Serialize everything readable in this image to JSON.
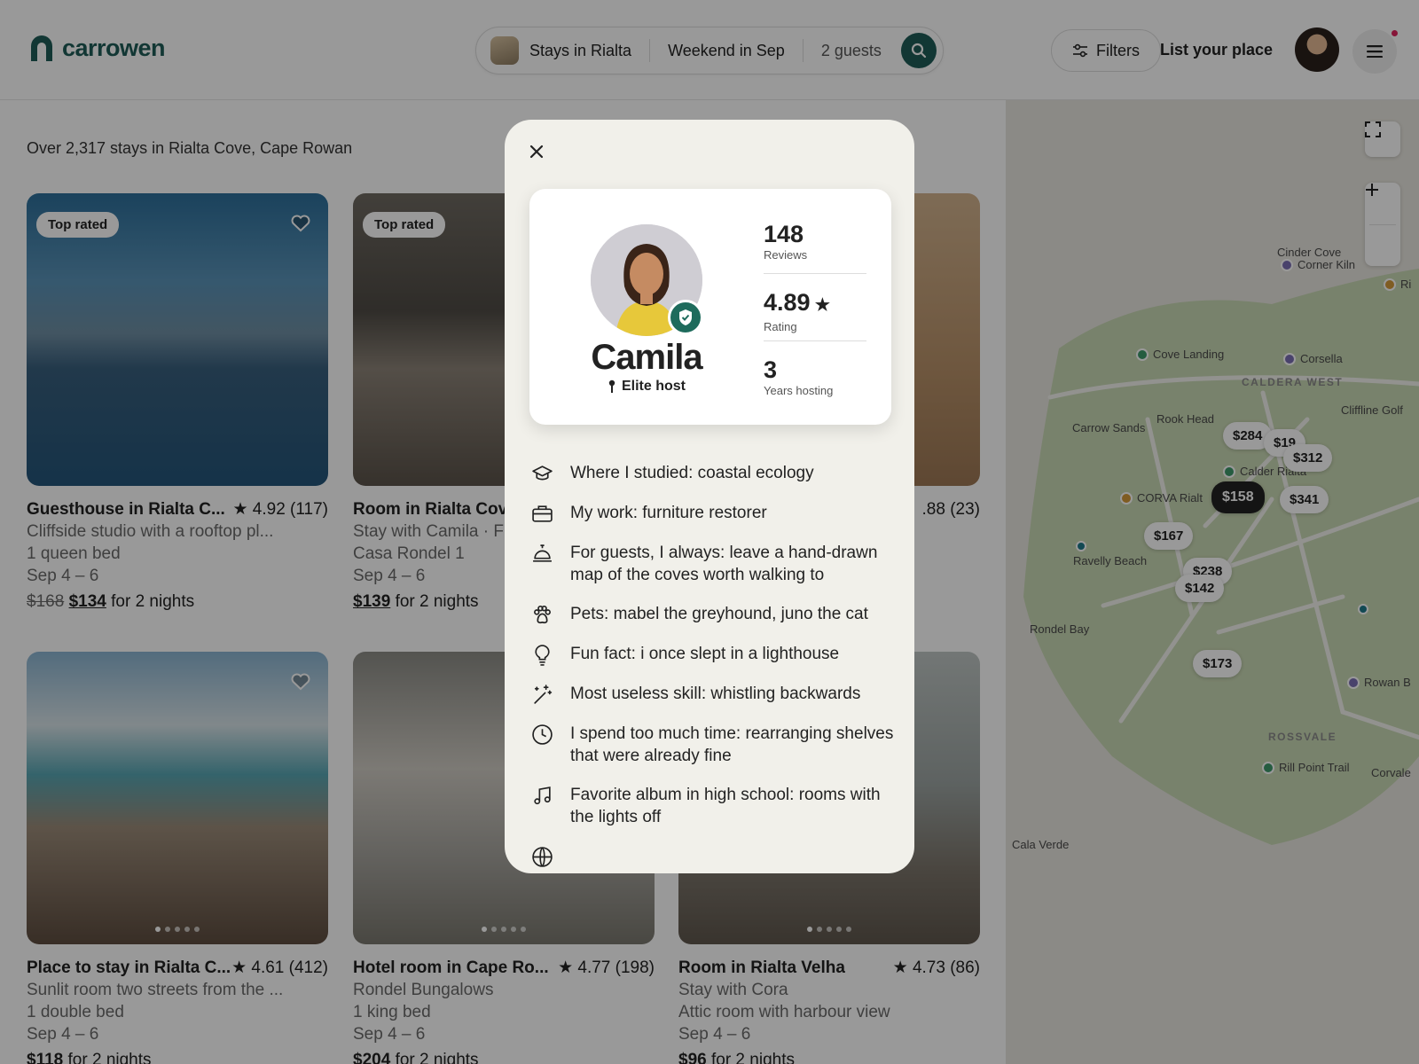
{
  "header": {
    "logo_text": "carrowen",
    "search": {
      "where": "Stays in Rialta",
      "when": "Weekend in Sep",
      "guests": "2 guests"
    },
    "filters_label": "Filters",
    "list_place_label": "List your place"
  },
  "results_text": "Over 2,317 stays in Rialta Cove, Cape Rowan",
  "listings": [
    {
      "badge": "Top rated",
      "title": "Guesthouse in Rialta C...",
      "rating": "★ 4.92 (117)",
      "line1": "Cliffside studio with a rooftop pl...",
      "line2": "1 queen bed",
      "dates": "Sep 4 – 6",
      "old_price": "$168",
      "price": "$134",
      "price_suffix": "for 2 nights"
    },
    {
      "badge": "Top rated",
      "title": "Room in Rialta Cove",
      "line1": "Stay with Camila · Fu",
      "line2": "Casa Rondel 1",
      "dates": "Sep 4 – 6",
      "price": "$139",
      "price_suffix": "for 2 nights"
    },
    {
      "rating": ".88 (23)"
    },
    {
      "title": "Place to stay in Rialta C...",
      "rating": "★ 4.61 (412)",
      "line1": "Sunlit room two streets from the ...",
      "line2": "1 double bed",
      "dates": "Sep 4 – 6",
      "price": "$118",
      "price_suffix": "for 2 nights"
    },
    {
      "title": "Hotel room in Cape Ro...",
      "rating": "★ 4.77 (198)",
      "line1": "Rondel Bungalows",
      "line2": "1 king bed",
      "dates": "Sep 4 – 6",
      "price": "$204",
      "price_suffix": "for 2 nights"
    },
    {
      "title": "Room in Rialta Velha",
      "rating": "★ 4.73 (86)",
      "line1": "Stay with Cora",
      "line2": "Attic room with harbour view",
      "dates": "Sep 4 – 6",
      "price": "$96",
      "price_suffix": "for 2 nights"
    }
  ],
  "map": {
    "prices": [
      "$284",
      "$19",
      "$312",
      "$158",
      "$341",
      "$167",
      "$238",
      "$142",
      "$173"
    ],
    "places": [
      "Cinder Cove",
      "Corner Kiln",
      "Ri",
      "Cove Landing",
      "Corsella",
      "Cliffline Golf",
      "Carrow Sands",
      "Rook Head",
      "Calder Rialta",
      "CORVA Rialt",
      "Ravelly Beach",
      "Rondel Bay",
      "Rowan B",
      "Rill Point Trail",
      "Corvale",
      "Cala Verde"
    ],
    "areas": [
      "CALDERA WEST",
      "ROSSVALE"
    ]
  },
  "host": {
    "name": "Camila",
    "role": "Elite host",
    "stats": [
      {
        "value": "148",
        "label": "Reviews"
      },
      {
        "value": "4.89",
        "label": "Rating"
      },
      {
        "value": "3",
        "label": "Years hosting"
      }
    ],
    "facts": [
      {
        "icon": "graduation-cap-icon",
        "text": "Where I studied: coastal ecology"
      },
      {
        "icon": "briefcase-icon",
        "text": "My work: furniture restorer"
      },
      {
        "icon": "service-bell-icon",
        "text": "For guests, I always: leave a hand-drawn map of the coves worth walking to"
      },
      {
        "icon": "paw-icon",
        "text": "Pets: mabel the greyhound, juno the cat"
      },
      {
        "icon": "lightbulb-icon",
        "text": "Fun fact: i once slept in a lighthouse"
      },
      {
        "icon": "magic-wand-icon",
        "text": "Most useless skill: whistling backwards"
      },
      {
        "icon": "clock-icon",
        "text": "I spend too much time: rearranging shelves that were already fine"
      },
      {
        "icon": "music-note-icon",
        "text": "Favorite album in high school: rooms with the lights off"
      }
    ]
  },
  "colors": {
    "brand": "#1e5c58",
    "verify": "#1e6b5c",
    "notification": "#e0245e"
  }
}
